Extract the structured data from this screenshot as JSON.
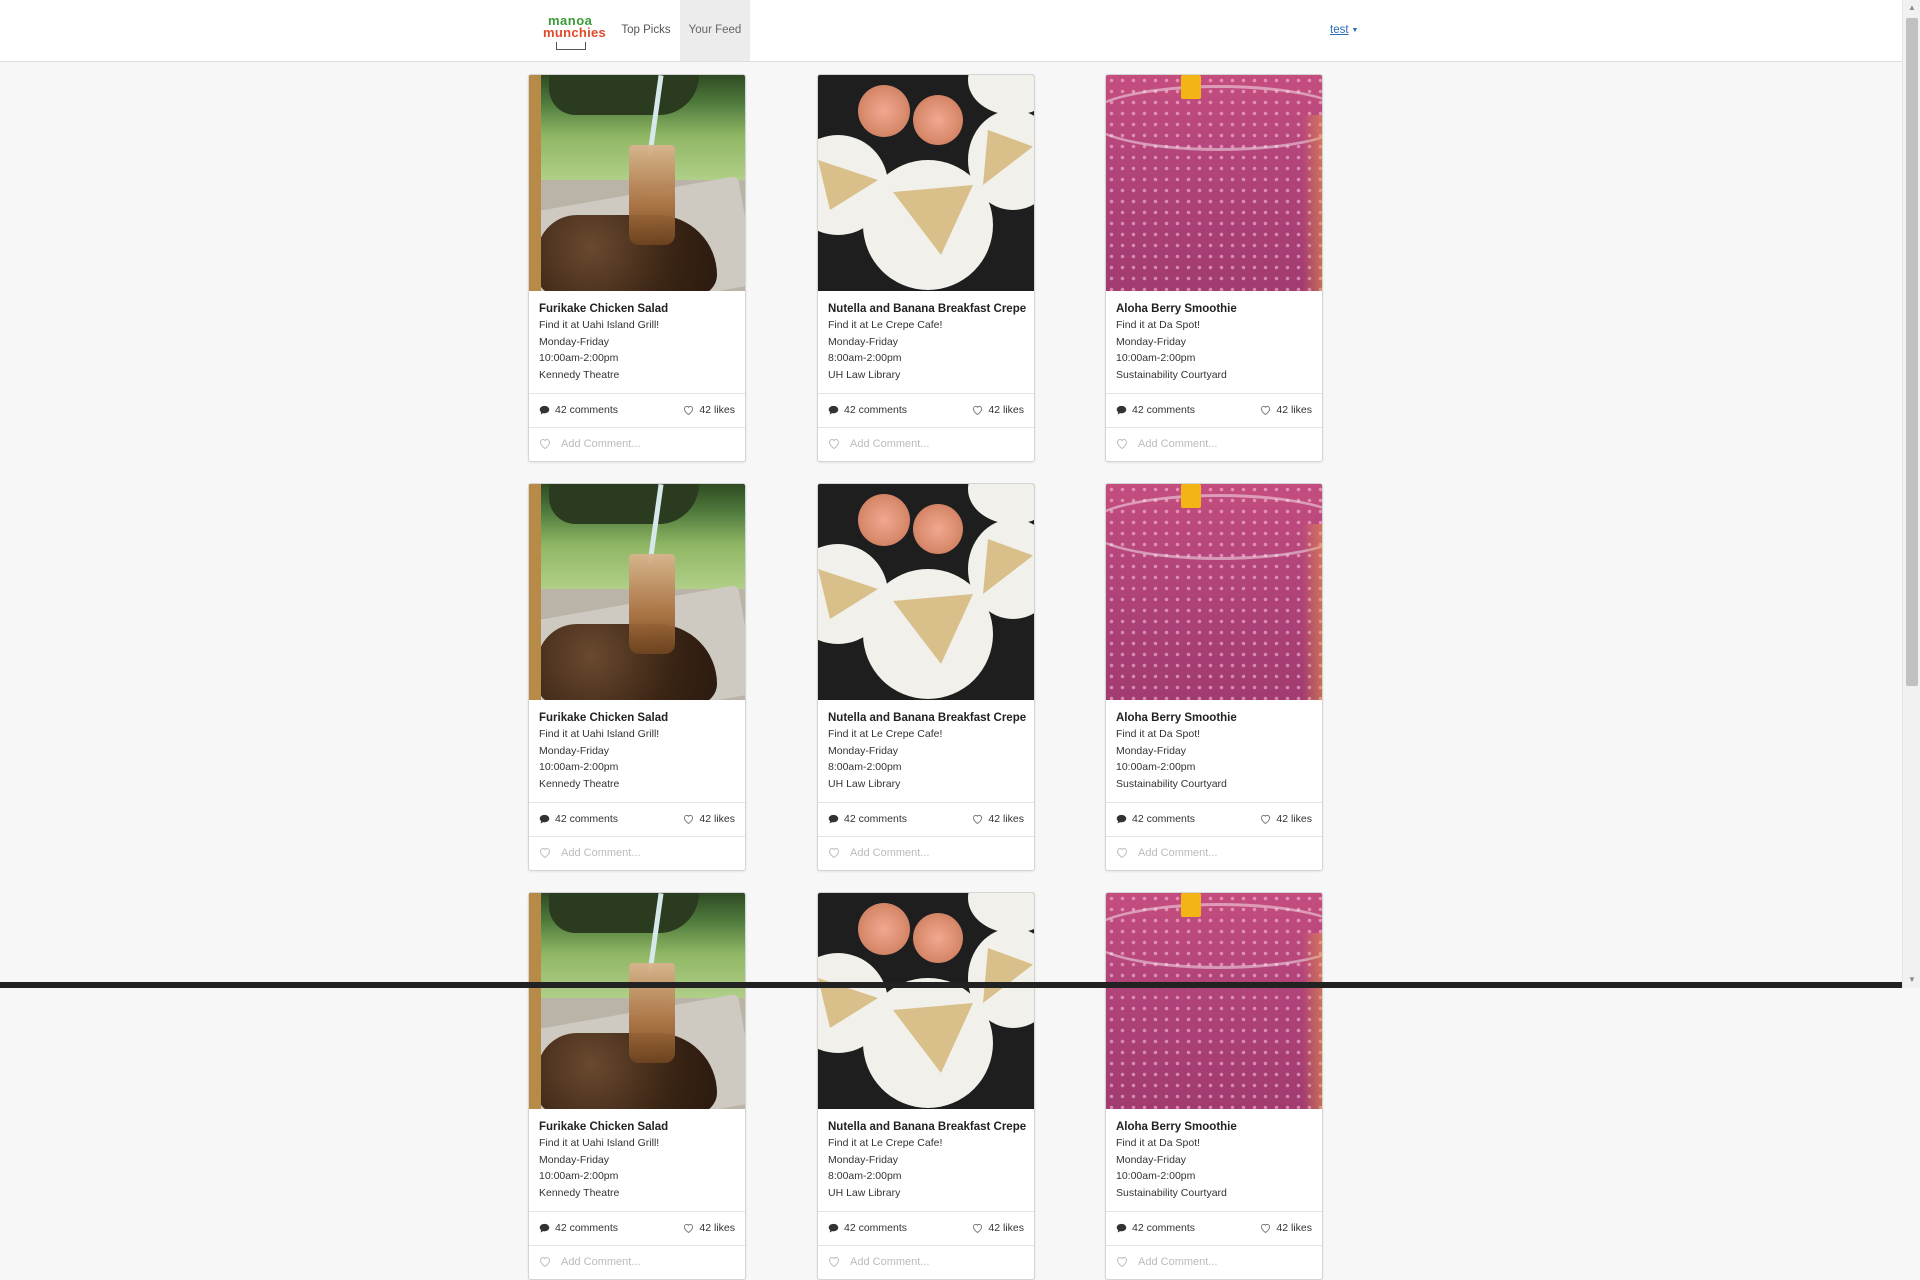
{
  "brand": {
    "logo_line1": "manoa",
    "logo_line2": "munchies"
  },
  "nav": {
    "top_picks": "Top Picks",
    "your_feed": "Your Feed"
  },
  "user": {
    "name": "test",
    "caret": "▼"
  },
  "cards": [
    {
      "title": "Furikake Chicken Salad",
      "where": "Find it at Uahi Island Grill!",
      "days": "Monday-Friday",
      "hours": "10:00am-2:00pm",
      "location": "Kennedy Theatre",
      "comments": "42 comments",
      "likes": "42 likes",
      "comment_placeholder": "Add Comment...",
      "photo": "salad"
    },
    {
      "title": "Nutella and Banana Breakfast Crepe",
      "where": "Find it at Le Crepe Cafe!",
      "days": "Monday-Friday",
      "hours": "8:00am-2:00pm",
      "location": "UH Law Library",
      "comments": "42 comments",
      "likes": "42 likes",
      "comment_placeholder": "Add Comment...",
      "photo": "crepe"
    },
    {
      "title": "Aloha Berry Smoothie",
      "where": "Find it at Da Spot!",
      "days": "Monday-Friday",
      "hours": "10:00am-2:00pm",
      "location": "Sustainability Courtyard",
      "comments": "42 comments",
      "likes": "42 likes",
      "comment_placeholder": "Add Comment...",
      "photo": "smoothie"
    },
    {
      "title": "Furikake Chicken Salad",
      "where": "Find it at Uahi Island Grill!",
      "days": "Monday-Friday",
      "hours": "10:00am-2:00pm",
      "location": "Kennedy Theatre",
      "comments": "42 comments",
      "likes": "42 likes",
      "comment_placeholder": "Add Comment...",
      "photo": "salad"
    },
    {
      "title": "Nutella and Banana Breakfast Crepe",
      "where": "Find it at Le Crepe Cafe!",
      "days": "Monday-Friday",
      "hours": "8:00am-2:00pm",
      "location": "UH Law Library",
      "comments": "42 comments",
      "likes": "42 likes",
      "comment_placeholder": "Add Comment...",
      "photo": "crepe"
    },
    {
      "title": "Aloha Berry Smoothie",
      "where": "Find it at Da Spot!",
      "days": "Monday-Friday",
      "hours": "10:00am-2:00pm",
      "location": "Sustainability Courtyard",
      "comments": "42 comments",
      "likes": "42 likes",
      "comment_placeholder": "Add Comment...",
      "photo": "smoothie"
    },
    {
      "title": "Furikake Chicken Salad",
      "where": "Find it at Uahi Island Grill!",
      "days": "Monday-Friday",
      "hours": "10:00am-2:00pm",
      "location": "Kennedy Theatre",
      "comments": "42 comments",
      "likes": "42 likes",
      "comment_placeholder": "Add Comment...",
      "photo": "salad"
    },
    {
      "title": "Nutella and Banana Breakfast Crepe",
      "where": "Find it at Le Crepe Cafe!",
      "days": "Monday-Friday",
      "hours": "8:00am-2:00pm",
      "location": "UH Law Library",
      "comments": "42 comments",
      "likes": "42 likes",
      "comment_placeholder": "Add Comment...",
      "photo": "crepe"
    },
    {
      "title": "Aloha Berry Smoothie",
      "where": "Find it at Da Spot!",
      "days": "Monday-Friday",
      "hours": "10:00am-2:00pm",
      "location": "Sustainability Courtyard",
      "comments": "42 comments",
      "likes": "42 likes",
      "comment_placeholder": "Add Comment...",
      "photo": "smoothie"
    }
  ],
  "icons": {
    "comment": "speech-bubble-icon",
    "like": "heart-icon"
  },
  "colors": {
    "link": "#2a6bb8",
    "logo_green": "#3a9a3a",
    "logo_red": "#e04b2a"
  }
}
